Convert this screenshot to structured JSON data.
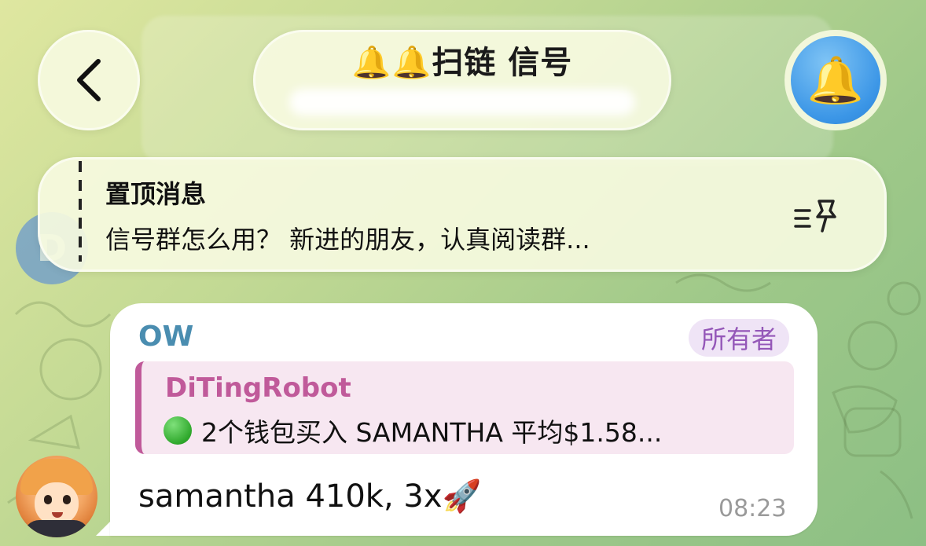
{
  "header": {
    "back_icon": "chevron-left-icon",
    "title": "🔔🔔扫链 信号",
    "avatar_icon": "🔔"
  },
  "pinned": {
    "title": "置顶消息",
    "body": "信号群怎么用？ 新进的朋友，认真阅读群...",
    "icon": "pin-list-icon"
  },
  "side_avatar_letter": "D",
  "message": {
    "sender": "OW",
    "badge": "所有者",
    "reply": {
      "name": "DiTingRobot",
      "text": "2个钱包买入 SAMANTHA 平均$1.58..."
    },
    "text": "samantha 410k, 3x🚀",
    "time": "08:23"
  },
  "colors": {
    "sender": "#4a8db0",
    "reply_accent": "#c05a9a",
    "owner_badge": "#9457b8"
  }
}
